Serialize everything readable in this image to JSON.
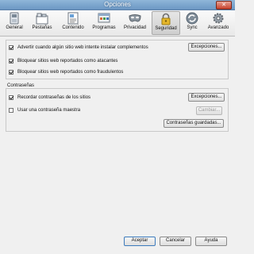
{
  "window": {
    "title": "Opciones",
    "close_label": "✕"
  },
  "toolbar": {
    "items": [
      {
        "label": "General",
        "icon": "switch-icon"
      },
      {
        "label": "Pestañas",
        "icon": "tabs-icon"
      },
      {
        "label": "Contenido",
        "icon": "content-icon"
      },
      {
        "label": "Programas",
        "icon": "applications-icon"
      },
      {
        "label": "Privacidad",
        "icon": "mask-icon"
      },
      {
        "label": "Seguridad",
        "icon": "lock-icon",
        "active": true
      },
      {
        "label": "Sync",
        "icon": "sync-icon"
      },
      {
        "label": "Avanzado",
        "icon": "gear-icon"
      }
    ]
  },
  "security": {
    "warn_addons": {
      "label": "Advertir cuando algún sitio web intente instalar complementos",
      "checked": true
    },
    "exceptions1_label": "Excepciones...",
    "block_attack": {
      "label": "Bloquear sitios web reportados como atacantes",
      "checked": true
    },
    "block_forgery": {
      "label": "Bloquear sitios web reportados como fraudulentos",
      "checked": true
    }
  },
  "passwords": {
    "section_title": "Contraseñas",
    "remember": {
      "label": "Recordar contraseñas de los sitios",
      "checked": true
    },
    "exceptions2_label": "Excepciones...",
    "master": {
      "label": "Usar una contraseña maestra",
      "checked": false
    },
    "change_label": "Cambiar...",
    "saved_label": "Contraseñas guardadas..."
  },
  "footer": {
    "accept": "Aceptar",
    "cancel": "Cancelar",
    "help": "Ayuda"
  },
  "colors": {
    "titlebar": "#7aa3cc",
    "window_bg": "#f0f0f0",
    "default_button_border": "#3d7bbd"
  }
}
